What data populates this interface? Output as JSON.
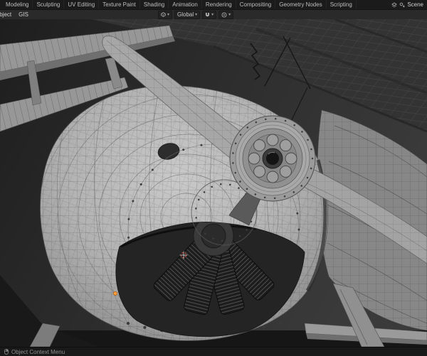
{
  "topbar": {
    "tabs": [
      "Modeling",
      "Sculpting",
      "UV Editing",
      "Texture Paint",
      "Shading",
      "Animation",
      "Rendering",
      "Compositing",
      "Geometry Nodes",
      "Scripting"
    ],
    "scene_label": "Scene"
  },
  "header": {
    "object_menu": "Object",
    "gis_menu": "GIS",
    "orientation_label": "Global"
  },
  "statusbar": {
    "context_menu_label": "Object Context Menu"
  },
  "icons": {
    "chevron_down": "▾"
  },
  "viewport": {
    "content_description": "Wireframe clay render of a biplane nose: propeller, spinner hub with bolt circles, radial engine cylinders inside cowling, hangar ceiling grid",
    "colors": {
      "viewport_background": "#2e2e2e",
      "model_gray": "#b2b2b2",
      "wire_gray": "#7a7a7a",
      "origin_orange": "#ff9d3d",
      "cursor_red": "#cc4439"
    }
  }
}
